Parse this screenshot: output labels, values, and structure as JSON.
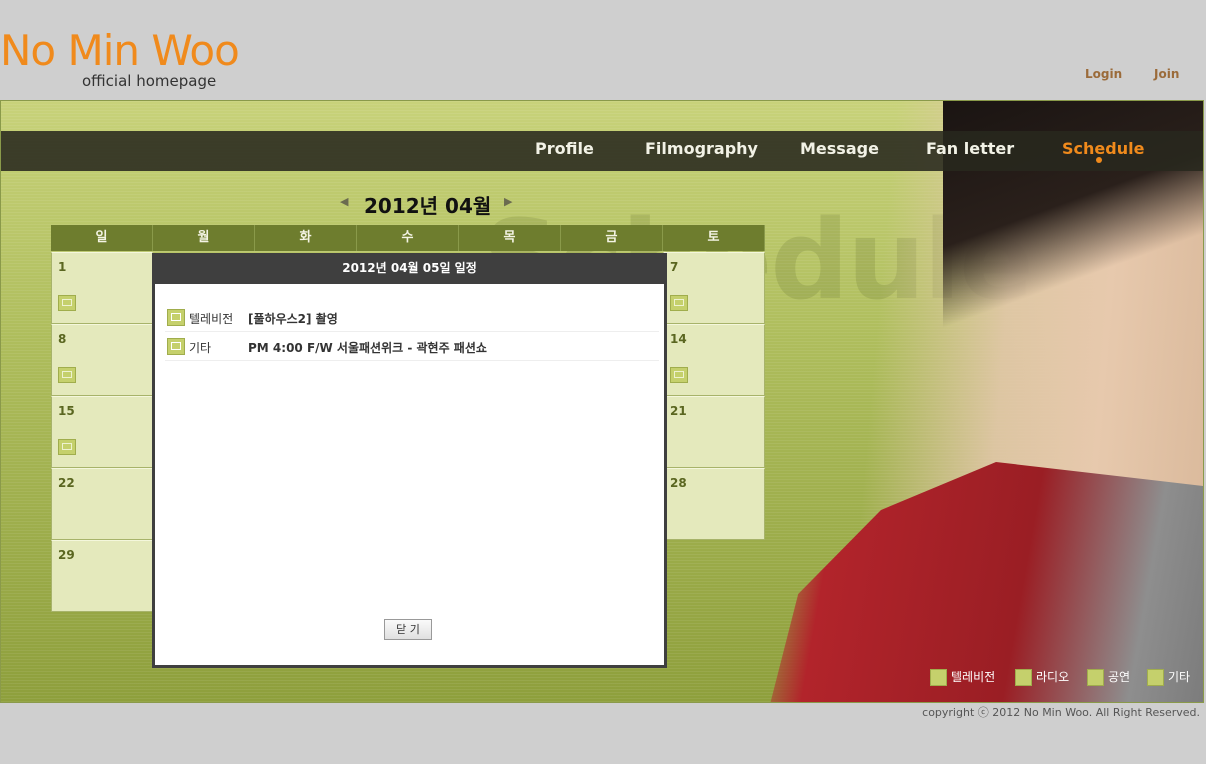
{
  "header": {
    "logo_title": "No Min Woo",
    "logo_subtitle": "official homepage",
    "login": "Login",
    "join": "Join"
  },
  "nav": {
    "items": [
      "Profile",
      "Filmography",
      "Message",
      "Fan letter",
      "Schedule"
    ],
    "active": "Schedule"
  },
  "background_text": "Schedule",
  "calendar": {
    "prev_icon": "triangle-left",
    "next_icon": "triangle-right",
    "month_label": "2012년 04월",
    "weekdays": [
      "일",
      "월",
      "화",
      "수",
      "목",
      "금",
      "토"
    ],
    "sunday_dates": [
      "1",
      "8",
      "15",
      "22",
      "29"
    ],
    "saturday_dates": [
      "7",
      "14",
      "21",
      "28"
    ]
  },
  "popup": {
    "title": "2012년 04월 05일 일정",
    "events": [
      {
        "category": "텔레비전",
        "icon": "tv-icon",
        "text": "[풀하우스2] 촬영"
      },
      {
        "category": "기타",
        "icon": "person-icon",
        "text": "PM 4:00 F/W 서울패션위크 - 곽현주 패션쇼"
      }
    ],
    "close_label": "닫 기"
  },
  "legend": {
    "items": [
      {
        "label": "텔레비전",
        "icon": "tv-icon"
      },
      {
        "label": "라디오",
        "icon": "radio-icon"
      },
      {
        "label": "공연",
        "icon": "music-note-icon"
      },
      {
        "label": "기타",
        "icon": "person-icon"
      }
    ]
  },
  "footer": {
    "copyright": "copyright ⓒ 2012 No Min Woo. All Right Reserved."
  },
  "colors": {
    "accent": "#f08a1c",
    "stage": "#aebd5c",
    "header_bar": "#6e7d2e",
    "popup_header": "#3f3f3f"
  }
}
